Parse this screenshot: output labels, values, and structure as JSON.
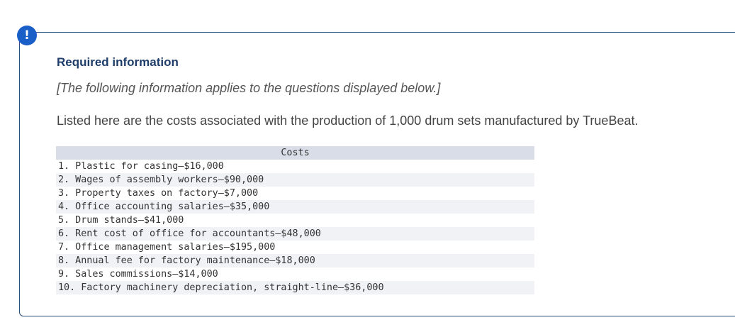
{
  "alert": {
    "icon": "exclamation-icon",
    "symbol": "!",
    "color": "#1a5ec8"
  },
  "panel": {
    "title": "Required information",
    "subtitle": "[The following information applies to the questions displayed below.]",
    "intro": "Listed here are the costs associated with the production of 1,000 drum sets manufactured by TrueBeat.",
    "title_color": "#1f3d6b"
  },
  "table": {
    "header": "Costs",
    "rows": [
      "1. Plastic for casing—$16,000",
      "2. Wages of assembly workers—$90,000",
      "3. Property taxes on factory—$7,000",
      "4. Office accounting salaries—$35,000",
      "5. Drum stands—$41,000",
      "6. Rent cost of office for accountants—$48,000",
      "7. Office management salaries—$195,000",
      "8. Annual fee for factory maintenance—$18,000",
      "9. Sales commissions—$14,000",
      "10. Factory machinery depreciation, straight-line—$36,000"
    ]
  }
}
